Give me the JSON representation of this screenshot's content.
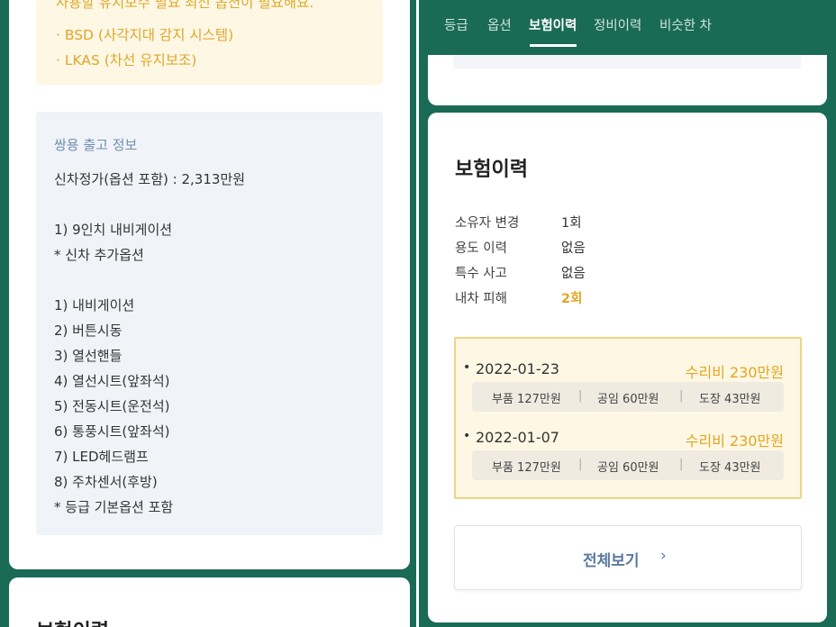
{
  "left": {
    "clipped_line": "사용할 유지보수 필요 최신 옵션이 필요해요.",
    "yellow_items": [
      "· BSD (사각지대 감지 시스템)",
      "· LKAS (차선 유지보조)"
    ],
    "factory_info": {
      "title": "쌍용 출고 정보",
      "price": "신차정가(옵션 포함) : 2,313만원",
      "lines": [
        "1) 9인치 내비게이션",
        "* 신차 추가옵션",
        "",
        "1) 내비게이션",
        "2) 버튼시동",
        "3) 열선핸들",
        "4) 열선시트(앞좌석)",
        "5) 전동시트(운전석)",
        "6) 통풍시트(앞좌석)",
        "7) LED헤드램프",
        "8) 주차센서(후방)",
        "* 등급 기본옵션 포함"
      ]
    },
    "next_section_peek": "보험이력"
  },
  "right": {
    "tabs": [
      "등급",
      "옵션",
      "보험이력",
      "정비이력",
      "비슷한 차"
    ],
    "active_tab": "보험이력",
    "insurance": {
      "title": "보험이력",
      "rows": [
        {
          "label": "소유자 변경",
          "value": "1회"
        },
        {
          "label": "용도 이력",
          "value": "없음"
        },
        {
          "label": "특수 사고",
          "value": "없음"
        },
        {
          "label": "내차 피해",
          "value": "2회"
        }
      ],
      "accidents": [
        {
          "date": "2022-01-23",
          "cost": "수리비 230만원",
          "parts": "부품 127만원",
          "labor": "공임 60만원",
          "paint": "도장 43만원"
        },
        {
          "date": "2022-01-07",
          "cost": "수리비 230만원",
          "parts": "부품 127만원",
          "labor": "공임 60만원",
          "paint": "도장 43만원"
        }
      ],
      "view_all": "전체보기",
      "view_all_icon": "chevron-right-icon"
    }
  },
  "colors": {
    "brand_green": "#1a6b55",
    "highlight": "#e3a521",
    "link_blue": "#5a7aa0"
  }
}
